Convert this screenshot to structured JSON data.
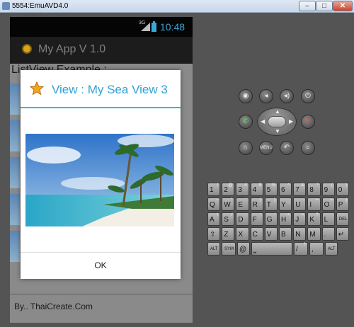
{
  "window": {
    "title": "5554:EmuAVD4.0",
    "minimize": "–",
    "maximize": "□",
    "close": "✕"
  },
  "status_bar": {
    "network": "3G",
    "time": "10:48"
  },
  "action_bar": {
    "app_name": "My App V 1.0"
  },
  "activity": {
    "heading": "ListView Example :",
    "footer": "By.. ThaiCreate.Com"
  },
  "dialog": {
    "title": "View : My Sea View 3",
    "ok_label": "OK"
  },
  "controls": {
    "camera": "◉",
    "volume_down": "◂",
    "volume_up": "◂)",
    "power": "⏻",
    "call": "✆",
    "end_call": "✆",
    "home": "⌂",
    "menu": "MENU",
    "back": "↶",
    "search": "⌕"
  },
  "keyboard": {
    "rows": [
      [
        {
          "k": "1",
          "s": "!"
        },
        {
          "k": "2",
          "s": "@"
        },
        {
          "k": "3",
          "s": "#"
        },
        {
          "k": "4",
          "s": "$"
        },
        {
          "k": "5",
          "s": "%"
        },
        {
          "k": "6",
          "s": "^"
        },
        {
          "k": "7",
          "s": "&"
        },
        {
          "k": "8",
          "s": "*"
        },
        {
          "k": "9",
          "s": "("
        },
        {
          "k": "0",
          "s": ")"
        }
      ],
      [
        {
          "k": "Q",
          "s": "~"
        },
        {
          "k": "W",
          "s": "\""
        },
        {
          "k": "E",
          "s": "`"
        },
        {
          "k": "R",
          "s": "{"
        },
        {
          "k": "T",
          "s": "}"
        },
        {
          "k": "Y",
          "s": "_"
        },
        {
          "k": "U",
          "s": "-"
        },
        {
          "k": "I",
          "s": "+"
        },
        {
          "k": "O",
          "s": "="
        },
        {
          "k": "P",
          "s": "|"
        }
      ],
      [
        {
          "k": "A",
          "s": "\\"
        },
        {
          "k": "S",
          "s": "/"
        },
        {
          "k": "D",
          "s": ":"
        },
        {
          "k": "F",
          "s": ";"
        },
        {
          "k": "G",
          "s": "'"
        },
        {
          "k": "H",
          "s": "<"
        },
        {
          "k": "J",
          "s": ">"
        },
        {
          "k": "K",
          "s": "?"
        },
        {
          "k": "L",
          "s": ""
        },
        {
          "k": "DEL",
          "s": ""
        }
      ],
      [
        {
          "k": "⇧",
          "s": ""
        },
        {
          "k": "Z",
          "s": ""
        },
        {
          "k": "X",
          "s": ""
        },
        {
          "k": "C",
          "s": ""
        },
        {
          "k": "V",
          "s": ""
        },
        {
          "k": "B",
          "s": ""
        },
        {
          "k": "N",
          "s": ""
        },
        {
          "k": "M",
          "s": ""
        },
        {
          "k": ".",
          "s": ""
        },
        {
          "k": "↵",
          "s": ""
        }
      ],
      [
        {
          "k": "ALT",
          "s": ""
        },
        {
          "k": "SYM",
          "s": ""
        },
        {
          "k": "@",
          "s": ""
        },
        {
          "k": "⎵",
          "s": ""
        },
        {
          "k": "/",
          "s": "?"
        },
        {
          "k": ",",
          "s": ""
        },
        {
          "k": "ALT",
          "s": ""
        }
      ]
    ]
  },
  "colors": {
    "accent": "#33b5e5",
    "clock": "#39a7d9",
    "star": "#f2a61a"
  }
}
